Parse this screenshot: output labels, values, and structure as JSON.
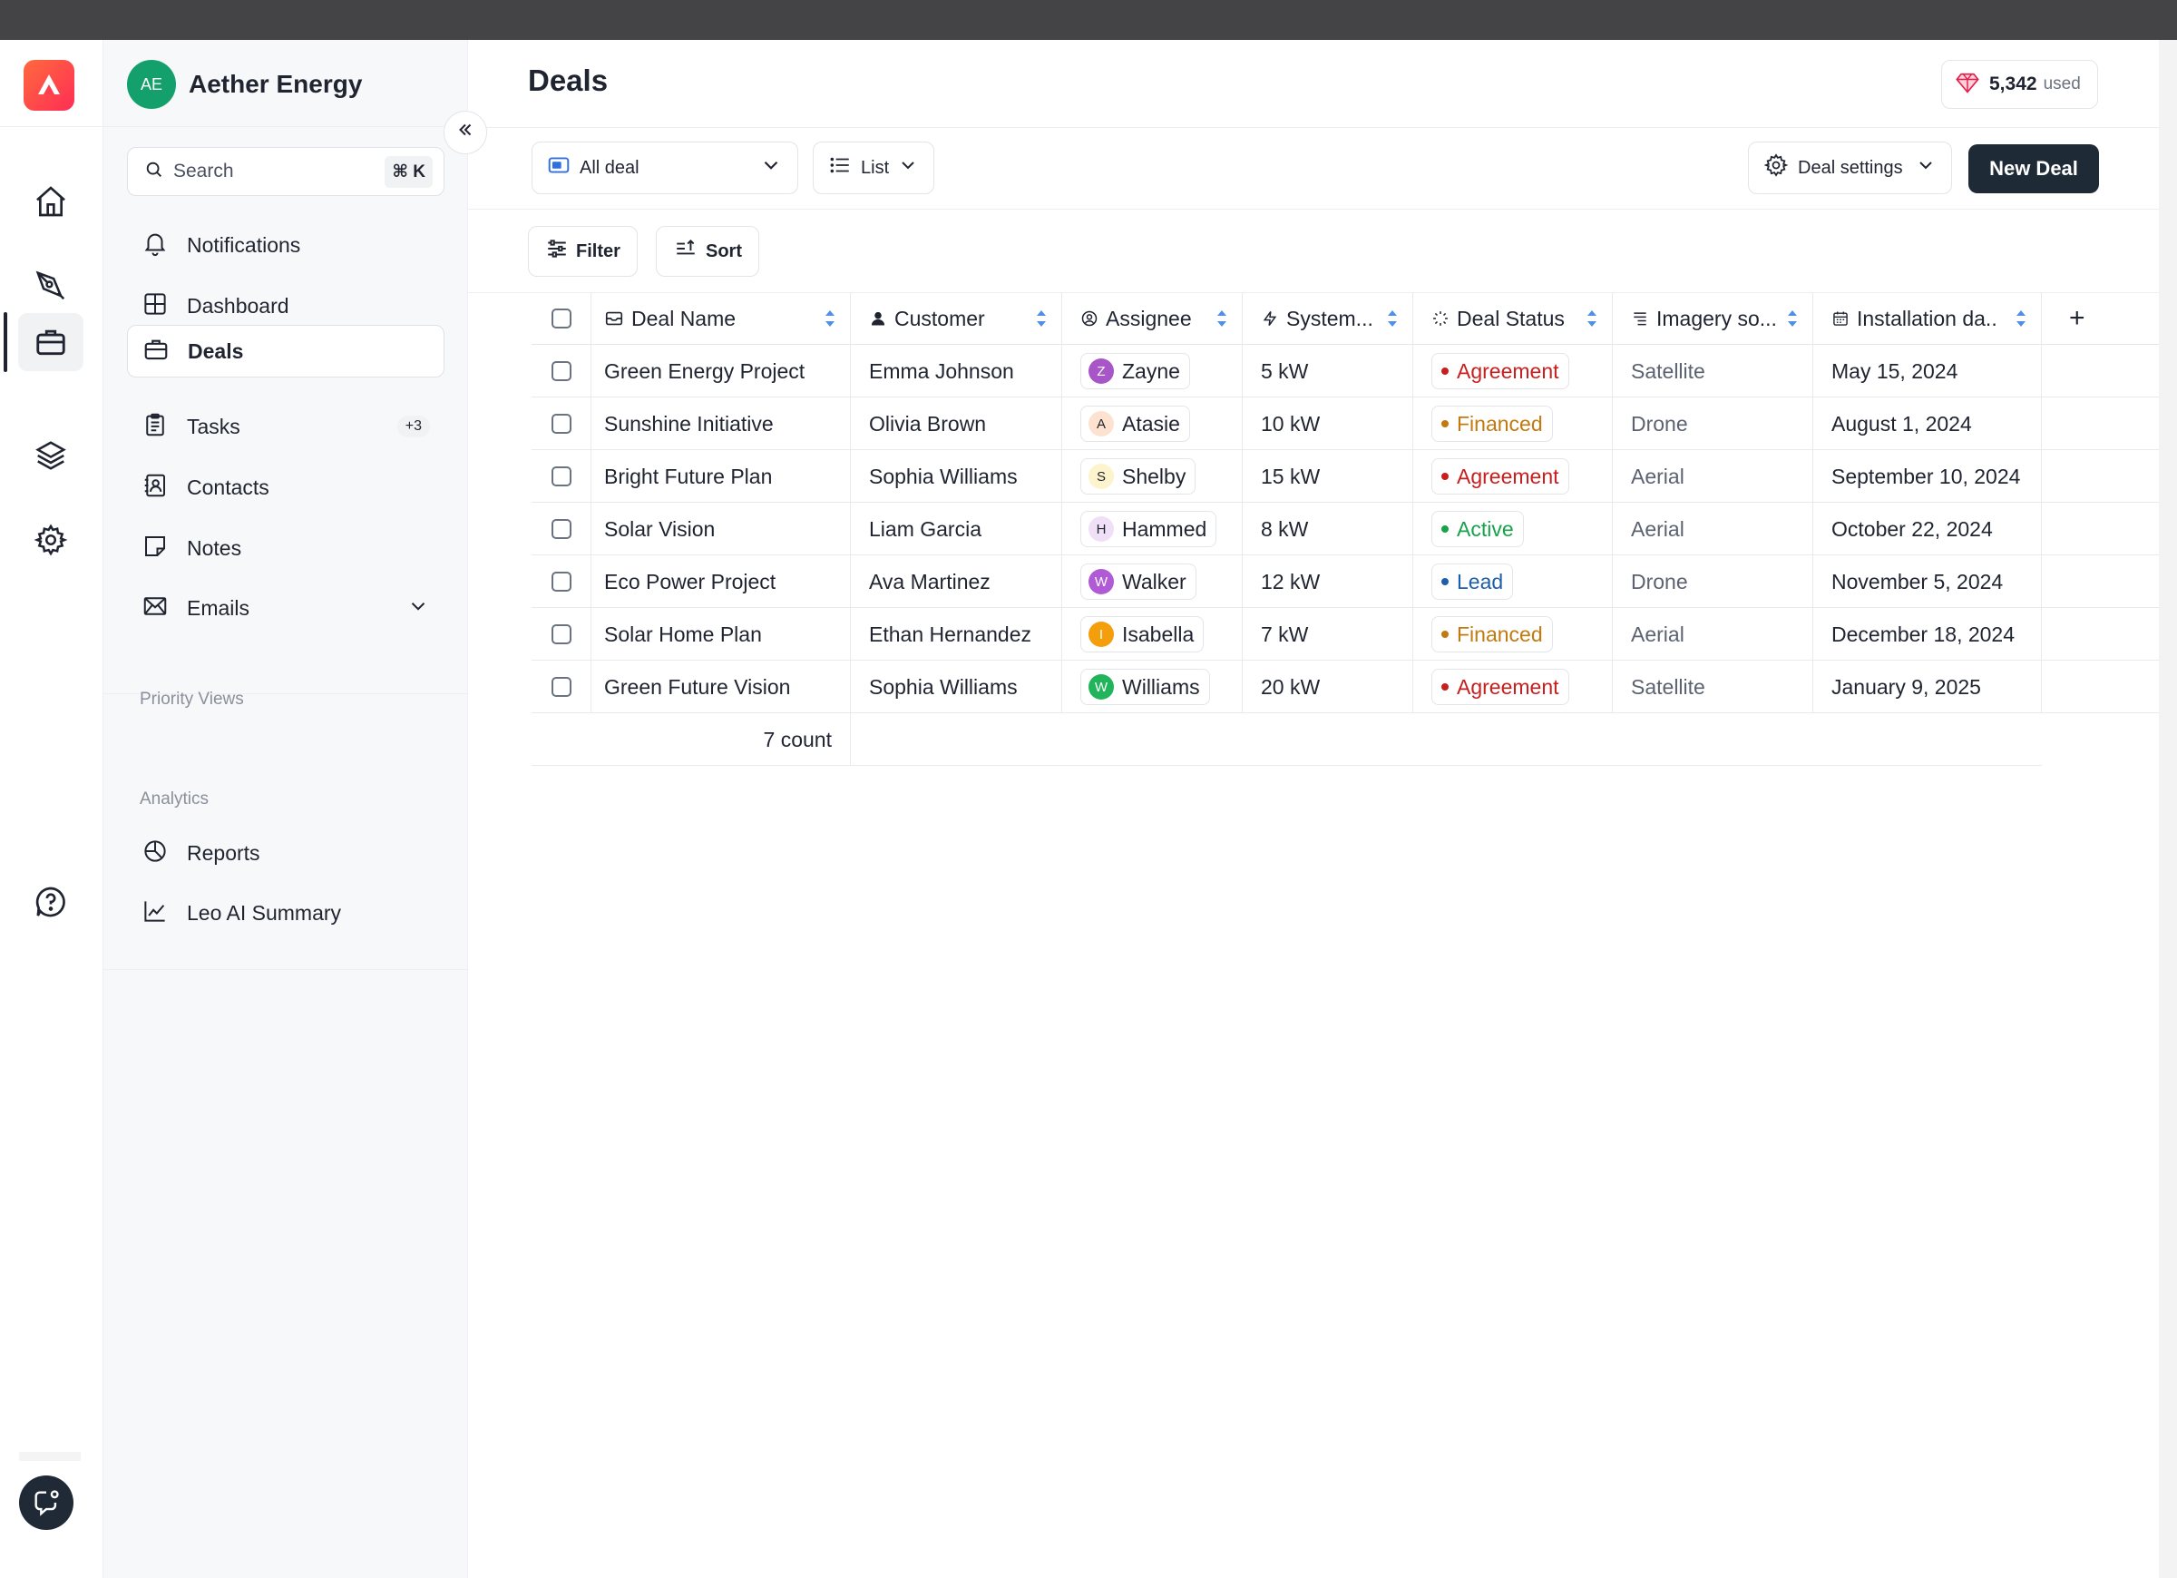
{
  "workspace": {
    "initials": "AE",
    "name": "Aether Energy"
  },
  "search": {
    "placeholder": "Search",
    "shortcut": "⌘ K"
  },
  "nav": {
    "items": [
      {
        "label": "Notifications",
        "icon": "bell-icon"
      },
      {
        "label": "Dashboard",
        "icon": "dashboard-icon"
      },
      {
        "label": "Deals",
        "icon": "briefcase-icon",
        "active": true
      },
      {
        "label": "Tasks",
        "icon": "clipboard-icon",
        "badge": "+3"
      },
      {
        "label": "Contacts",
        "icon": "contacts-icon"
      },
      {
        "label": "Notes",
        "icon": "note-icon"
      },
      {
        "label": "Emails",
        "icon": "mail-icon",
        "expandable": true
      }
    ],
    "priority_views_label": "Priority Views",
    "analytics_label": "Analytics",
    "analytics_items": [
      {
        "label": "Reports",
        "icon": "pie-chart-icon"
      },
      {
        "label": "Leo AI Summary",
        "icon": "line-chart-icon"
      }
    ]
  },
  "rail": {
    "icons": [
      "home-icon",
      "pen-tool-icon",
      "briefcase-icon",
      "layers-icon",
      "settings-icon",
      "help-icon",
      "chat-icon"
    ]
  },
  "header": {
    "title": "Deals",
    "credits_value": "5,342",
    "credits_suffix": "used"
  },
  "toolbar": {
    "view_select": "All deal",
    "layout_select": "List",
    "settings_label": "Deal settings",
    "new_deal_label": "New Deal",
    "filter_label": "Filter",
    "sort_label": "Sort"
  },
  "table": {
    "columns": [
      {
        "label": "Deal Name",
        "icon": "inbox-icon"
      },
      {
        "label": "Customer",
        "icon": "user-icon"
      },
      {
        "label": "Assignee",
        "icon": "user-circle-icon"
      },
      {
        "label": "System...",
        "icon": "bolt-icon"
      },
      {
        "label": "Deal Status",
        "icon": "loader-icon"
      },
      {
        "label": "Imagery so...",
        "icon": "list-icon"
      },
      {
        "label": "Installation da..",
        "icon": "calendar-icon"
      }
    ],
    "rows": [
      {
        "deal": "Green Energy Project",
        "customer": "Emma Johnson",
        "assignee": "Zayne",
        "initial": "Z",
        "avatar_bg": "#a855c7",
        "avatar_fg": "#ffffff",
        "system": "5 kW",
        "status": "Agreement",
        "status_color": "#c81e1e",
        "imagery": "Satellite",
        "date": "May 15, 2024"
      },
      {
        "deal": "Sunshine Initiative",
        "customer": "Olivia Brown",
        "assignee": "Atasie",
        "initial": "A",
        "avatar_bg": "#fde2cf",
        "avatar_fg": "#1f2430",
        "system": "10 kW",
        "status": "Financed",
        "status_color": "#c27a0e",
        "imagery": "Drone",
        "date": "August 1, 2024"
      },
      {
        "deal": "Bright Future Plan",
        "customer": "Sophia Williams",
        "assignee": "Shelby",
        "initial": "S",
        "avatar_bg": "#fdf3cc",
        "avatar_fg": "#1f2430",
        "system": "15 kW",
        "status": "Agreement",
        "status_color": "#c81e1e",
        "imagery": "Aerial",
        "date": "September 10, 2024"
      },
      {
        "deal": "Solar Vision",
        "customer": "Liam Garcia",
        "assignee": "Hammed",
        "initial": "H",
        "avatar_bg": "#efe0f7",
        "avatar_fg": "#1f2430",
        "system": "8 kW",
        "status": "Active",
        "status_color": "#16a34a",
        "imagery": "Aerial",
        "date": "October 22, 2024"
      },
      {
        "deal": "Eco Power Project",
        "customer": "Ava Martinez",
        "assignee": "Walker",
        "initial": "W",
        "avatar_bg": "#b05ad6",
        "avatar_fg": "#ffffff",
        "system": "12 kW",
        "status": "Lead",
        "status_color": "#1d5fa8",
        "imagery": "Drone",
        "date": "November 5, 2024"
      },
      {
        "deal": "Solar Home Plan",
        "customer": "Ethan Hernandez",
        "assignee": "Isabella",
        "initial": "I",
        "avatar_bg": "#f59e0b",
        "avatar_fg": "#ffffff",
        "system": "7 kW",
        "status": "Financed",
        "status_color": "#c27a0e",
        "imagery": "Aerial",
        "date": "December 18, 2024"
      },
      {
        "deal": "Green Future Vision",
        "customer": "Sophia Williams",
        "assignee": "Williams",
        "initial": "W",
        "avatar_bg": "#22b45a",
        "avatar_fg": "#ffffff",
        "system": "20 kW",
        "status": "Agreement",
        "status_color": "#c81e1e",
        "imagery": "Satellite",
        "date": "January 9, 2025"
      }
    ],
    "footer_count": "7 count",
    "add_column": "+"
  }
}
